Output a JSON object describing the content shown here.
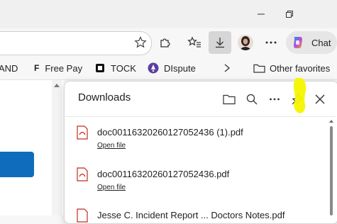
{
  "toolbar": {
    "chat_label": "Chat"
  },
  "favorites": {
    "items": [
      {
        "label": "AND"
      },
      {
        "label": "Free Pay"
      },
      {
        "label": "TOCK"
      },
      {
        "label": "DIspute"
      }
    ],
    "other_label": "Other favorites"
  },
  "downloads": {
    "title": "Downloads",
    "files": [
      {
        "name": "doc00116320260127052436 (1).pdf",
        "action": "Open file"
      },
      {
        "name": "doc00116320260127052436.pdf",
        "action": "Open file"
      },
      {
        "name": "Jesse C. Incident Report ... Doctors Notes.pdf"
      }
    ]
  },
  "colors": {
    "accent": "#0f6cbd",
    "highlight": "#f5f500",
    "pdf_red": "#c42b1c"
  }
}
